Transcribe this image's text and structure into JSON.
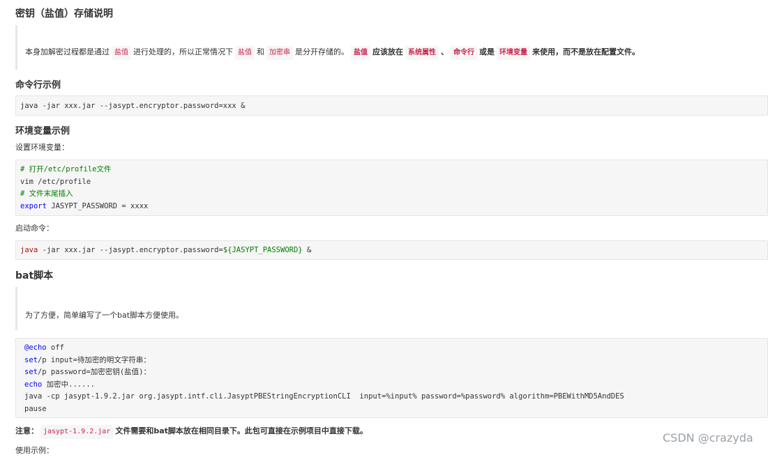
{
  "section_salt": {
    "title": "密钥（盐值）存储说明",
    "para": {
      "p1": "本身加解密过程都是通过",
      "t1": "盐值",
      "p2": "进行处理的，所以正常情况下",
      "t2": "盐值",
      "p3": "和",
      "t3": "加密串",
      "p4": "是分开存储的。",
      "t4": "盐值",
      "p5": "应该放在",
      "t5": "系统属性",
      "p6": "、",
      "t6": "命令行",
      "p7": "或是",
      "t7": "环境变量",
      "p8": "来使用，而不是放在配置文件。"
    }
  },
  "section_cli": {
    "title": "命令行示例",
    "code": "java -jar xxx.jar --jasypt.encryptor.password=xxx &"
  },
  "section_env": {
    "title": "环境变量示例",
    "set_label": "设置环境变量：",
    "code_lines": {
      "l1": "# 打开/etc/profile文件",
      "l2": "vim /etc/profile",
      "l3": "# 文件末尾插入",
      "l4_kw": "export",
      "l4_rest": " JASYPT_PASSWORD = xxxx"
    },
    "start_label": "启动命令：",
    "start_code": {
      "kw": "java",
      "mid": " -jar xxx.jar --jasypt.encryptor.password=",
      "var": "${JASYPT_PASSWORD}",
      "tail": " &"
    }
  },
  "section_bat": {
    "title": "bat脚本",
    "para": "为了方便，简单编写了一个bat脚本方便使用。",
    "code_lines": {
      "l1_kw": "@echo",
      "l1_rest": " off",
      "l2_kw": "set",
      "l2_rest": "/p input=待加密的明文字符串：",
      "l3_kw": "set",
      "l3_rest": "/p password=加密密钥(盐值)：",
      "l4_kw": "echo",
      "l4_rest": " 加密中......",
      "l5": "java -cp jasypt-1.9.2.jar org.jasypt.intf.cli.JasyptPBEStringEncryptionCLI  input=%input% password=%password% algorithm=PBEWithMD5AndDES",
      "l6": "pause"
    }
  },
  "note": {
    "label": "注意：",
    "tag": "jasypt-1.9.2.jar",
    "text": "文件需要和bat脚本放在相同目录下。此包可直接在示例项目中直接下载。"
  },
  "usage_label": "使用示例：",
  "watermark": "CSDN @crazyda"
}
